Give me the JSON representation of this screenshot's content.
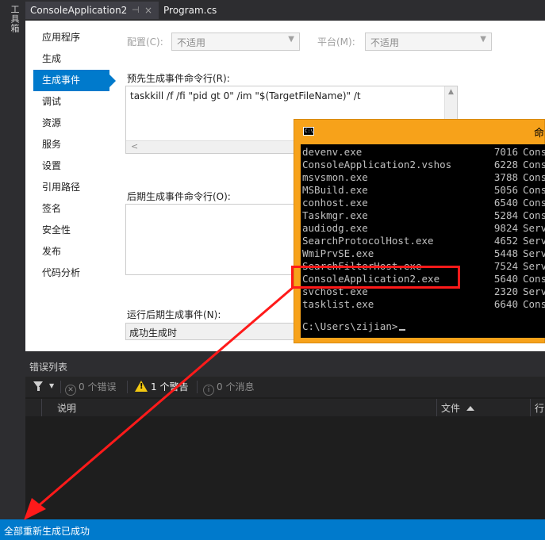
{
  "toolbox": {
    "label": "工具箱"
  },
  "tabs": [
    {
      "label": "ConsoleApplication2",
      "pin": "⊣",
      "close": "×"
    },
    {
      "label": "Program.cs"
    }
  ],
  "nav": {
    "items": [
      "应用程序",
      "生成",
      "生成事件",
      "调试",
      "资源",
      "服务",
      "设置",
      "引用路径",
      "签名",
      "安全性",
      "发布",
      "代码分析"
    ],
    "active": "生成事件"
  },
  "config": {
    "config_label": "配置(C):",
    "config_value": "不适用",
    "platform_label": "平台(M):",
    "platform_value": "不适用"
  },
  "prebuild": {
    "label": "预先生成事件命令行(R):",
    "command": "taskkill /f /fi \"pid gt 0\" /im \"$(TargetFileName)\" /t"
  },
  "postbuild": {
    "label": "后期生成事件命令行(O):"
  },
  "run_postbuild": {
    "label": "运行后期生成事件(N):",
    "value": "成功生成时"
  },
  "console": {
    "title": "命",
    "rows": [
      {
        "name": "devenv.exe",
        "pid": "7016",
        "session": "Cons"
      },
      {
        "name": "ConsoleApplication2.vshos",
        "pid": "6228",
        "session": "Cons"
      },
      {
        "name": "msvsmon.exe",
        "pid": "3788",
        "session": "Cons"
      },
      {
        "name": "MSBuild.exe",
        "pid": "5056",
        "session": "Cons"
      },
      {
        "name": "conhost.exe",
        "pid": "6540",
        "session": "Cons"
      },
      {
        "name": "Taskmgr.exe",
        "pid": "5284",
        "session": "Cons"
      },
      {
        "name": "audiodg.exe",
        "pid": "9824",
        "session": "Serv"
      },
      {
        "name": "SearchProtocolHost.exe",
        "pid": "4652",
        "session": "Serv"
      },
      {
        "name": "WmiPrvSE.exe",
        "pid": "5448",
        "session": "Serv"
      },
      {
        "name": "SearchFilterHost.exe",
        "pid": "7524",
        "session": "Serv"
      },
      {
        "name": "ConsoleApplication2.exe",
        "pid": "5640",
        "session": "Cons"
      },
      {
        "name": "svchost.exe",
        "pid": "2320",
        "session": "Serv"
      },
      {
        "name": "tasklist.exe",
        "pid": "6640",
        "session": "Cons"
      }
    ],
    "prompt": "C:\\Users\\zijian>",
    "highlight_color": "#ff1a1a",
    "background_color": "#f7a21a"
  },
  "errorlist": {
    "title": "错误列表",
    "errors": "0 个错误",
    "warnings": "1 个警告",
    "messages": "0 个消息",
    "columns": {
      "description": "说明",
      "file": "文件",
      "line": "行"
    }
  },
  "status": {
    "text": "全部重新生成已成功"
  },
  "colors": {
    "accent": "#007acc",
    "arrow": "#ff1a1a"
  }
}
